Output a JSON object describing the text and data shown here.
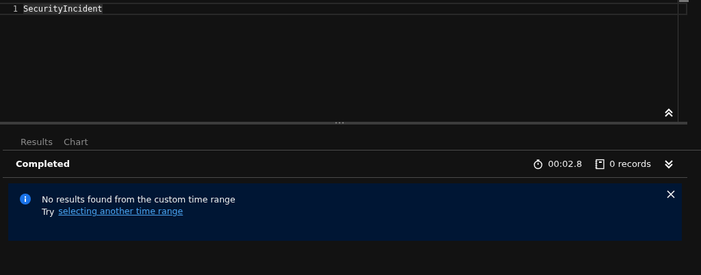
{
  "editor": {
    "lines": [
      {
        "number": "1",
        "code": "SecurityIncident"
      }
    ]
  },
  "tabs": [
    {
      "label": "Results",
      "selected": false
    },
    {
      "label": "Chart",
      "selected": false
    }
  ],
  "status": {
    "state": "Completed",
    "duration": "00:02.8",
    "records": "0 records"
  },
  "banner": {
    "message": "No results found from the custom time range",
    "prompt": "Try",
    "link": "selecting another time range"
  }
}
